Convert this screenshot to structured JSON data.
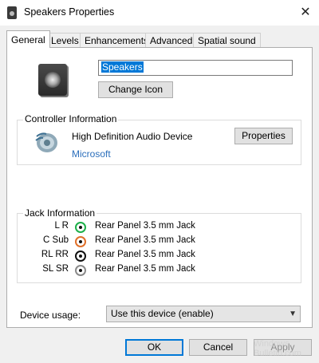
{
  "window": {
    "title": "Speakers Properties",
    "close_glyph": "✕"
  },
  "tabs": [
    {
      "label": "General"
    },
    {
      "label": "Levels"
    },
    {
      "label": "Enhancements"
    },
    {
      "label": "Advanced"
    },
    {
      "label": "Spatial sound"
    }
  ],
  "general": {
    "device_name": "Speakers",
    "change_icon_label": "Change Icon",
    "controller": {
      "group_label": "Controller Information",
      "name": "High Definition Audio Device",
      "vendor": "Microsoft",
      "vendor_color": "#2a6ebb",
      "properties_label": "Properties"
    },
    "jack": {
      "group_label": "Jack Information",
      "rows": [
        {
          "code": "L R",
          "color": "#1db04a",
          "description": "Rear Panel 3.5 mm Jack"
        },
        {
          "code": "C Sub",
          "color": "#e0702a",
          "description": "Rear Panel 3.5 mm Jack"
        },
        {
          "code": "RL RR",
          "color": "#111111",
          "description": "Rear Panel 3.5 mm Jack"
        },
        {
          "code": "SL SR",
          "color": "#8a8a8a",
          "description": "Rear Panel 3.5 mm Jack"
        }
      ]
    },
    "device_usage": {
      "label": "Device usage:",
      "value": "Use this device (enable)"
    }
  },
  "footer": {
    "ok_label": "OK",
    "cancel_label": "Cancel",
    "apply_label": "Apply"
  },
  "watermark": "Windows Bulletin.com",
  "colors": {
    "accent": "#0078d7",
    "ok_border": "#0078d7"
  }
}
